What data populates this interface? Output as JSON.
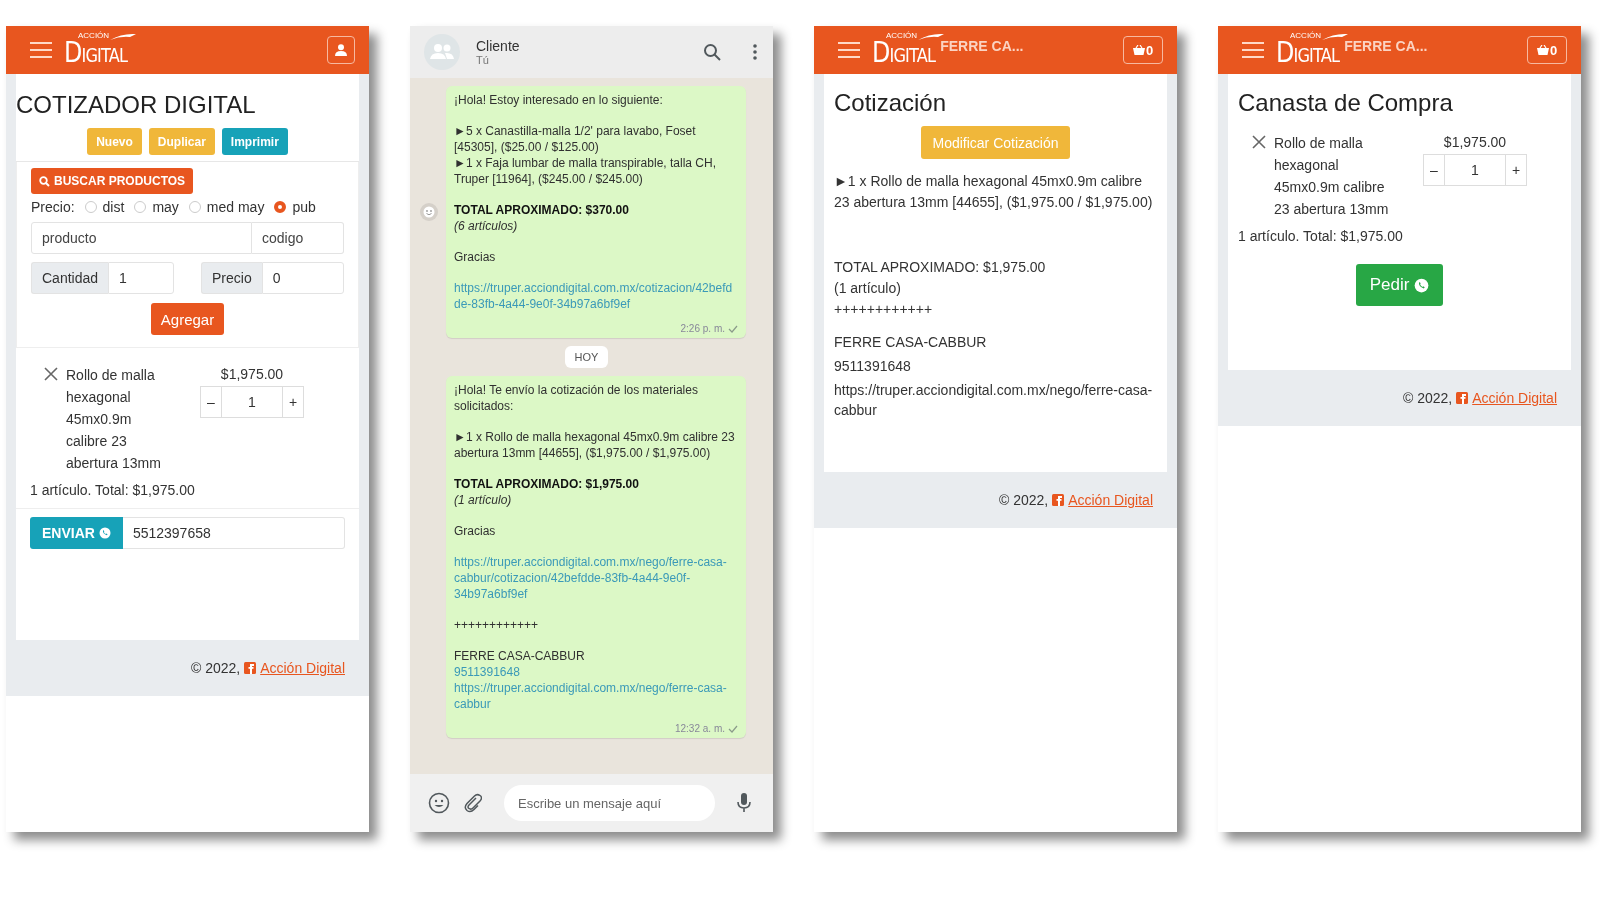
{
  "cotizador": {
    "header": {
      "logo_small": "ACCIÓN",
      "logo": "DIGITAL"
    },
    "title": "COTIZADOR DIGITAL",
    "actions": [
      {
        "label": "Nuevo",
        "color": "#f0b73a"
      },
      {
        "label": "Duplicar",
        "color": "#f0b73a"
      },
      {
        "label": "Imprimir",
        "color": "#17a2b8"
      }
    ],
    "search_button": "BUSCAR PRODUCTOS",
    "price_label": "Precio:",
    "price_options": [
      {
        "label": "dist",
        "selected": false
      },
      {
        "label": "may",
        "selected": false
      },
      {
        "label": "med may",
        "selected": false
      },
      {
        "label": "pub",
        "selected": true
      }
    ],
    "product_field": {
      "placeholder": "producto"
    },
    "code_field": {
      "placeholder": "codigo"
    },
    "quantity": {
      "label": "Cantidad",
      "value": "1"
    },
    "price": {
      "label": "Precio",
      "value": "0"
    },
    "add_button": "Agregar",
    "cart_item": {
      "name": "Rollo de malla hexagonal 45mx0.9m calibre 23 abertura 13mm",
      "price": "$1,975.00",
      "minus": "–",
      "qty": "1",
      "plus": "+"
    },
    "summary": "1 artículo. Total: $1,975.00",
    "send_button": "ENVIAR",
    "phone": "5512397658",
    "footer": {
      "copyright": "© 2022,",
      "link": "Acción Digital"
    }
  },
  "chat": {
    "contact": "Cliente",
    "subtitle": "Tú",
    "messages": [
      {
        "paragraphs": [
          [
            {
              "kind": "text",
              "text": "¡Hola! Estoy interesado en lo siguiente:"
            }
          ],
          [
            {
              "kind": "text",
              "text": "►5 x Canastilla-malla 1/2' para lavabo, Foset [45305], ($25.00 / $125.00)"
            },
            {
              "kind": "text",
              "text": "►1 x Faja lumbar de malla transpirable, talla CH, Truper [11964], ($245.00 / $245.00)"
            }
          ],
          [
            {
              "kind": "bold",
              "text": "TOTAL APROXIMADO: $370.00"
            },
            {
              "kind": "italic",
              "text": "(6 artículos)"
            }
          ],
          [
            {
              "kind": "text",
              "text": "Gracias"
            }
          ],
          [
            {
              "kind": "link",
              "text": "https://truper.acciondigital.com.mx/cotizacion/42befdde-83fb-4a44-9e0f-34b97a6bf9ef"
            }
          ]
        ],
        "time": "2:26 p. m."
      },
      {
        "paragraphs": [
          [
            {
              "kind": "text",
              "text": "¡Hola! Te envío la cotización de los materiales solicitados:"
            }
          ],
          [
            {
              "kind": "text",
              "text": "►1 x Rollo de malla hexagonal 45mx0.9m calibre 23 abertura 13mm [44655], ($1,975.00 / $1,975.00)"
            }
          ],
          [
            {
              "kind": "bold",
              "text": "TOTAL APROXIMADO: $1,975.00"
            },
            {
              "kind": "italic",
              "text": "(1 artículo)"
            }
          ],
          [
            {
              "kind": "text",
              "text": "Gracias"
            }
          ],
          [
            {
              "kind": "link",
              "text": "https://truper.acciondigital.com.mx/nego/ferre-casa-cabbur/cotizacion/42befdde-83fb-4a44-9e0f-34b97a6bf9ef"
            }
          ],
          [
            {
              "kind": "text",
              "text": "++++++++++++"
            }
          ],
          [
            {
              "kind": "text",
              "text": "FERRE CASA-CABBUR"
            },
            {
              "kind": "link",
              "text": "9511391648"
            },
            {
              "kind": "link",
              "text": "https://truper.acciondigital.com.mx/nego/ferre-casa-cabbur"
            }
          ]
        ],
        "time": "12:32 a. m."
      }
    ],
    "day_chip": "HOY",
    "input": {
      "placeholder": "Escribe un mensaje aquí"
    }
  },
  "cotizacion": {
    "header": {
      "logo_small": "ACCIÓN",
      "logo": "DIGITAL",
      "store": "FERRE CA...",
      "basket_count": "0"
    },
    "title": "Cotización",
    "edit_button": "Modificar Cotización",
    "item": "►1 x Rollo de malla hexagonal 45mx0.9m calibre 23 abertura 13mm [44655], ($1,975.00 / $1,975.00)",
    "lines": [
      "TOTAL APROXIMADO: $1,975.00",
      "(1 artículo)",
      "++++++++++++"
    ],
    "store_lines": [
      "FERRE CASA-CABBUR",
      "9511391648",
      "https://truper.acciondigital.com.mx/nego/ferre-casa-cabbur"
    ],
    "footer": {
      "copyright": "© 2022,",
      "link": "Acción Digital"
    }
  },
  "canasta": {
    "header": {
      "logo_small": "ACCIÓN",
      "logo": "DIGITAL",
      "store": "FERRE CA...",
      "basket_count": "0"
    },
    "title": "Canasta de Compra",
    "cart_item": {
      "name": "Rollo de malla hexagonal 45mx0.9m calibre 23 abertura 13mm",
      "price": "$1,975.00",
      "minus": "–",
      "qty": "1",
      "plus": "+"
    },
    "summary": "1 artículo. Total: $1,975.00",
    "order_button": "Pedir",
    "footer": {
      "copyright": "© 2022,",
      "link": "Acción Digital"
    }
  }
}
